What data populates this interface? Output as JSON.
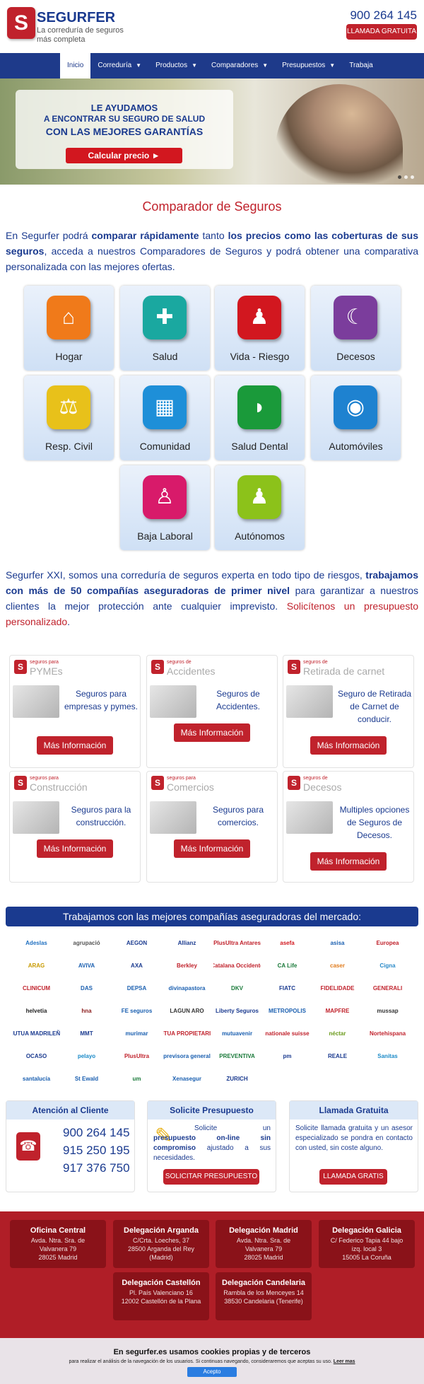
{
  "header": {
    "logo_text": "S",
    "brand": "SEGURFER",
    "tagline": "La correduría de seguros más completa",
    "phone": "900 264 145",
    "call_button": "LLAMADA GRATUITA"
  },
  "nav": {
    "items": [
      {
        "label": "Inicio",
        "has_menu": false
      },
      {
        "label": "Correduría",
        "has_menu": true
      },
      {
        "label": "Productos",
        "has_menu": true
      },
      {
        "label": "Comparadores",
        "has_menu": true
      },
      {
        "label": "Presupuestos",
        "has_menu": true
      },
      {
        "label": "Trabaja",
        "has_menu": false
      }
    ]
  },
  "hero": {
    "line1": "LE AYUDAMOS",
    "line2": "A ENCONTRAR SU SEGURO DE SALUD",
    "line3": "CON LAS MEJORES GARANTÍAS",
    "button": "Calcular precio ►"
  },
  "section_title": "Comparador de Seguros",
  "intro": {
    "p1": "En Segurfer podrá ",
    "b1": "comparar rápidamente",
    "p2": " tanto ",
    "b2": "los precios como las coberturas de sus seguros",
    "p3": ", acceda a nuestros Comparadores de Seguros y podrá obtener una comparativa personalizada con las mejores ofertas."
  },
  "tiles": [
    {
      "label": "Hogar",
      "icon": "house-icon",
      "color": "#f07a1a"
    },
    {
      "label": "Salud",
      "icon": "plus-icon",
      "color": "#1aa8a0"
    },
    {
      "label": "Vida - Riesgo",
      "icon": "family-icon",
      "color": "#d2171f"
    },
    {
      "label": "Decesos",
      "icon": "crescent-icon",
      "color": "#7b3d9c"
    },
    {
      "label": "Resp. Civil",
      "icon": "scales-icon",
      "color": "#e8c11a"
    },
    {
      "label": "Comunidad",
      "icon": "building-icon",
      "color": "#1e8fd8"
    },
    {
      "label": "Salud Dental",
      "icon": "tooth-icon",
      "color": "#1a9a3a"
    },
    {
      "label": "Automóviles",
      "icon": "car-icon",
      "color": "#1e82d0"
    },
    {
      "label": "Baja Laboral",
      "icon": "person-icon",
      "color": "#d81a6a"
    },
    {
      "label": "Autónomos",
      "icon": "group-icon",
      "color": "#8cc21a"
    }
  ],
  "about": {
    "p1": "Segurfer XXI, somos una correduría de seguros experta en todo tipo de riesgos, ",
    "b1": "trabajamos con más de 50 compañías aseguradoras de primer nivel",
    "p2": " para garantizar a nuestros clientes la mejor protección ante cualquier imprevisto. ",
    "link": "Solicítenos un presupuesto personalizado",
    "p3": "."
  },
  "cards": [
    {
      "small": "seguros para",
      "big": "PYMEs",
      "text": "Seguros para empresas y pymes.",
      "button": "Más Información"
    },
    {
      "small": "seguros de",
      "big": "Accidentes",
      "text": "Seguros de Accidentes.",
      "button": "Más Información"
    },
    {
      "small": "seguros de",
      "big": "Retirada de carnet",
      "text": "Seguro de Retirada de Carnet de conducir.",
      "button": "Más Información"
    },
    {
      "small": "seguros para",
      "big": "Construcción",
      "text": "Seguros para la construcción.",
      "button": "Más Información"
    },
    {
      "small": "seguros para",
      "big": "Comercios",
      "text": "Seguros para comercios.",
      "button": "Más Información"
    },
    {
      "small": "seguros de",
      "big": "Decesos",
      "text": "Multiples opciones de Seguros de Decesos.",
      "button": "Más Información"
    }
  ],
  "banner": "Trabajamos con las mejores compañías aseguradoras del mercado:",
  "insurers": [
    {
      "name": "Adeslas",
      "color": "#1e6fc0"
    },
    {
      "name": "agrupació",
      "color": "#555"
    },
    {
      "name": "AEGON",
      "color": "#1a3a8f"
    },
    {
      "name": "Allianz",
      "color": "#1a3a8f"
    },
    {
      "name": "PlusUltra Antares",
      "color": "#c0222c"
    },
    {
      "name": "asefa",
      "color": "#d2171f"
    },
    {
      "name": "asisa",
      "color": "#1a5fb0"
    },
    {
      "name": "Europea",
      "color": "#c0222c"
    },
    {
      "name": "ARAG",
      "color": "#c89a00"
    },
    {
      "name": "AVIVA",
      "color": "#1a5fb0"
    },
    {
      "name": "AXA",
      "color": "#1a3a8f"
    },
    {
      "name": "Berkley",
      "color": "#c0222c"
    },
    {
      "name": "Catalana Occidente",
      "color": "#c0222c"
    },
    {
      "name": "CA Life",
      "color": "#1a7a3a"
    },
    {
      "name": "caser",
      "color": "#e07a1a"
    },
    {
      "name": "Cigna",
      "color": "#2a8ac8"
    },
    {
      "name": "CLINICUM",
      "color": "#c0222c"
    },
    {
      "name": "DAS",
      "color": "#1a5fb0"
    },
    {
      "name": "DEPSA",
      "color": "#1a5fb0"
    },
    {
      "name": "divinapastora",
      "color": "#1a5fb0"
    },
    {
      "name": "DKV",
      "color": "#1a7a3a"
    },
    {
      "name": "FIATC",
      "color": "#1a3a8f"
    },
    {
      "name": "FIDELIDADE",
      "color": "#c0222c"
    },
    {
      "name": "GENERALI",
      "color": "#c0222c"
    },
    {
      "name": "helvetia",
      "color": "#222"
    },
    {
      "name": "hna",
      "color": "#8a1a1a"
    },
    {
      "name": "FE seguros",
      "color": "#1a5fb0"
    },
    {
      "name": "LAGUN ARO",
      "color": "#333"
    },
    {
      "name": "Liberty Seguros",
      "color": "#1a3a8f"
    },
    {
      "name": "METROPOLIS",
      "color": "#1a5fb0"
    },
    {
      "name": "MAPFRE",
      "color": "#c0222c"
    },
    {
      "name": "mussap",
      "color": "#333"
    },
    {
      "name": "MUTUA MADRILEÑA",
      "color": "#1a3a8f"
    },
    {
      "name": "MMT",
      "color": "#1a3a8f"
    },
    {
      "name": "murimar",
      "color": "#1a5fb0"
    },
    {
      "name": "MUTUA PROPIETARIOS",
      "color": "#c0222c"
    },
    {
      "name": "mutuavenir",
      "color": "#1a5fb0"
    },
    {
      "name": "nationale suisse",
      "color": "#c0222c"
    },
    {
      "name": "néctar",
      "color": "#6a9a1a"
    },
    {
      "name": "Nortehispana",
      "color": "#c0222c"
    },
    {
      "name": "OCASO",
      "color": "#1a3a8f"
    },
    {
      "name": "pelayo",
      "color": "#1a8ac8"
    },
    {
      "name": "PlusUltra",
      "color": "#c0222c"
    },
    {
      "name": "previsora general",
      "color": "#1a5fb0"
    },
    {
      "name": "PREVENTIVA",
      "color": "#1a7a3a"
    },
    {
      "name": "pm",
      "color": "#1a3a8f"
    },
    {
      "name": "REALE",
      "color": "#1a3a8f"
    },
    {
      "name": "Sanitas",
      "color": "#1a8ac8"
    },
    {
      "name": "santalucía",
      "color": "#1a5fb0"
    },
    {
      "name": "St Ewald",
      "color": "#1a5fb0"
    },
    {
      "name": "um",
      "color": "#1a7a3a"
    },
    {
      "name": "Xenasegur",
      "color": "#1a5fb0"
    },
    {
      "name": "ZURICH",
      "color": "#1a3a8f"
    }
  ],
  "contact": {
    "attention": {
      "title": "Atención al Cliente",
      "phones": [
        "900 264 145",
        "915 250 195",
        "917 376 750"
      ]
    },
    "quote": {
      "title": "Solicite Presupuesto",
      "t1": "Solicite un ",
      "b1": "presupuesto on-line sin compromiso",
      "t2": " ajustado a sus necesidades.",
      "button": "SOLICITAR PRESUPUESTO"
    },
    "free_call": {
      "title": "Llamada Gratuita",
      "text": "Solicite llamada gratuita y un asesor especializado se pondra en contacto con usted, sin coste alguno.",
      "button": "LLAMADA GRATIS"
    }
  },
  "offices": [
    {
      "title": "Oficina Central",
      "l1": "Avda. Ntra. Sra. de",
      "l2": "Valvanera 79",
      "l3": "28025 Madrid"
    },
    {
      "title": "Delegación Arganda",
      "l1": "C/Crta. Loeches, 37",
      "l2": "28500 Arganda del Rey",
      "l3": "(Madrid)"
    },
    {
      "title": "Delegación Madrid",
      "l1": "Avda. Ntra. Sra. de",
      "l2": "Valvanera 79",
      "l3": "28025 Madrid"
    },
    {
      "title": "Delegación Galicia",
      "l1": "C/ Federico Tapia 44 bajo",
      "l2": "izq. local 3",
      "l3": "15005 La Coruña"
    },
    {
      "title": "Delegación Castellón",
      "l1": "Pl. País Valenciano 16",
      "l2": "12002 Castellón de la Plana",
      "l3": ""
    },
    {
      "title": "Delegación Candelaria",
      "l1": "Rambla de los Menceyes 14",
      "l2": "38530 Candelaria (Tenerife)",
      "l3": ""
    }
  ],
  "cookie": {
    "title": "En segurfer.es usamos cookies propias y de terceros",
    "text": "para realizar el análisis de la navegación de los usuarios. Si continuas navegando, consideraremos que aceptas su uso.",
    "link": "Leer mas",
    "button": "Acepto"
  }
}
